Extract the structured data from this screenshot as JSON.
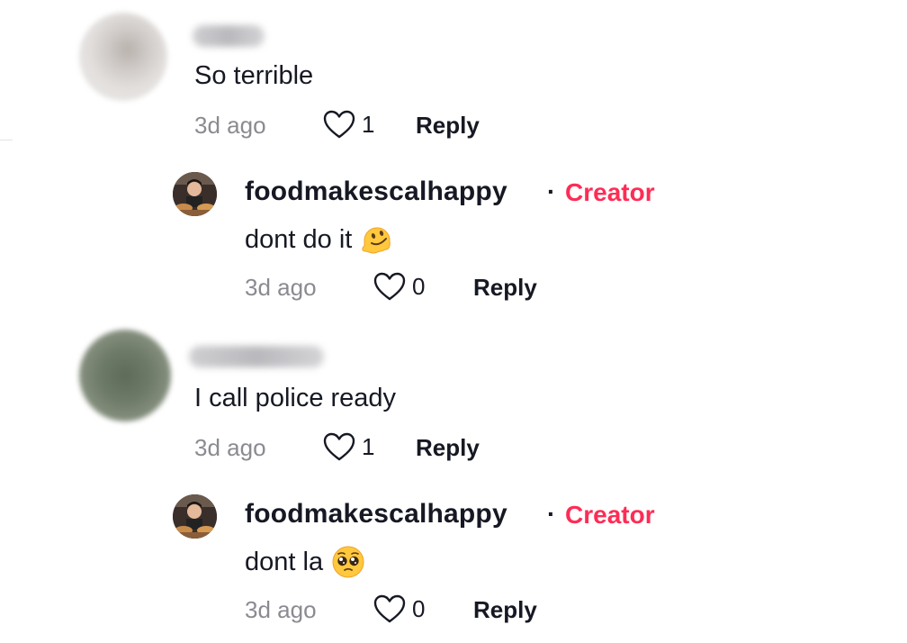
{
  "comments": [
    {
      "text": "So terrible",
      "time": "3d ago",
      "likes": "1",
      "reply_label": "Reply",
      "reply": {
        "username": "foodmakescalhappy",
        "badge": "Creator",
        "separator": "·",
        "text": "dont do it",
        "emoji": "melting-face-emoji",
        "time": "3d ago",
        "likes": "0",
        "reply_label": "Reply"
      }
    },
    {
      "text": "I call police ready",
      "time": "3d ago",
      "likes": "1",
      "reply_label": "Reply",
      "reply": {
        "username": "foodmakescalhappy",
        "badge": "Creator",
        "separator": "·",
        "text": "dont la",
        "emoji": "pleading-face-emoji",
        "time": "3d ago",
        "likes": "0",
        "reply_label": "Reply"
      }
    }
  ],
  "colors": {
    "creator_badge": "#fe2c55",
    "text_primary": "#161823",
    "text_secondary": "#8a8b91"
  },
  "icons": {
    "like": "heart-outline-icon"
  }
}
